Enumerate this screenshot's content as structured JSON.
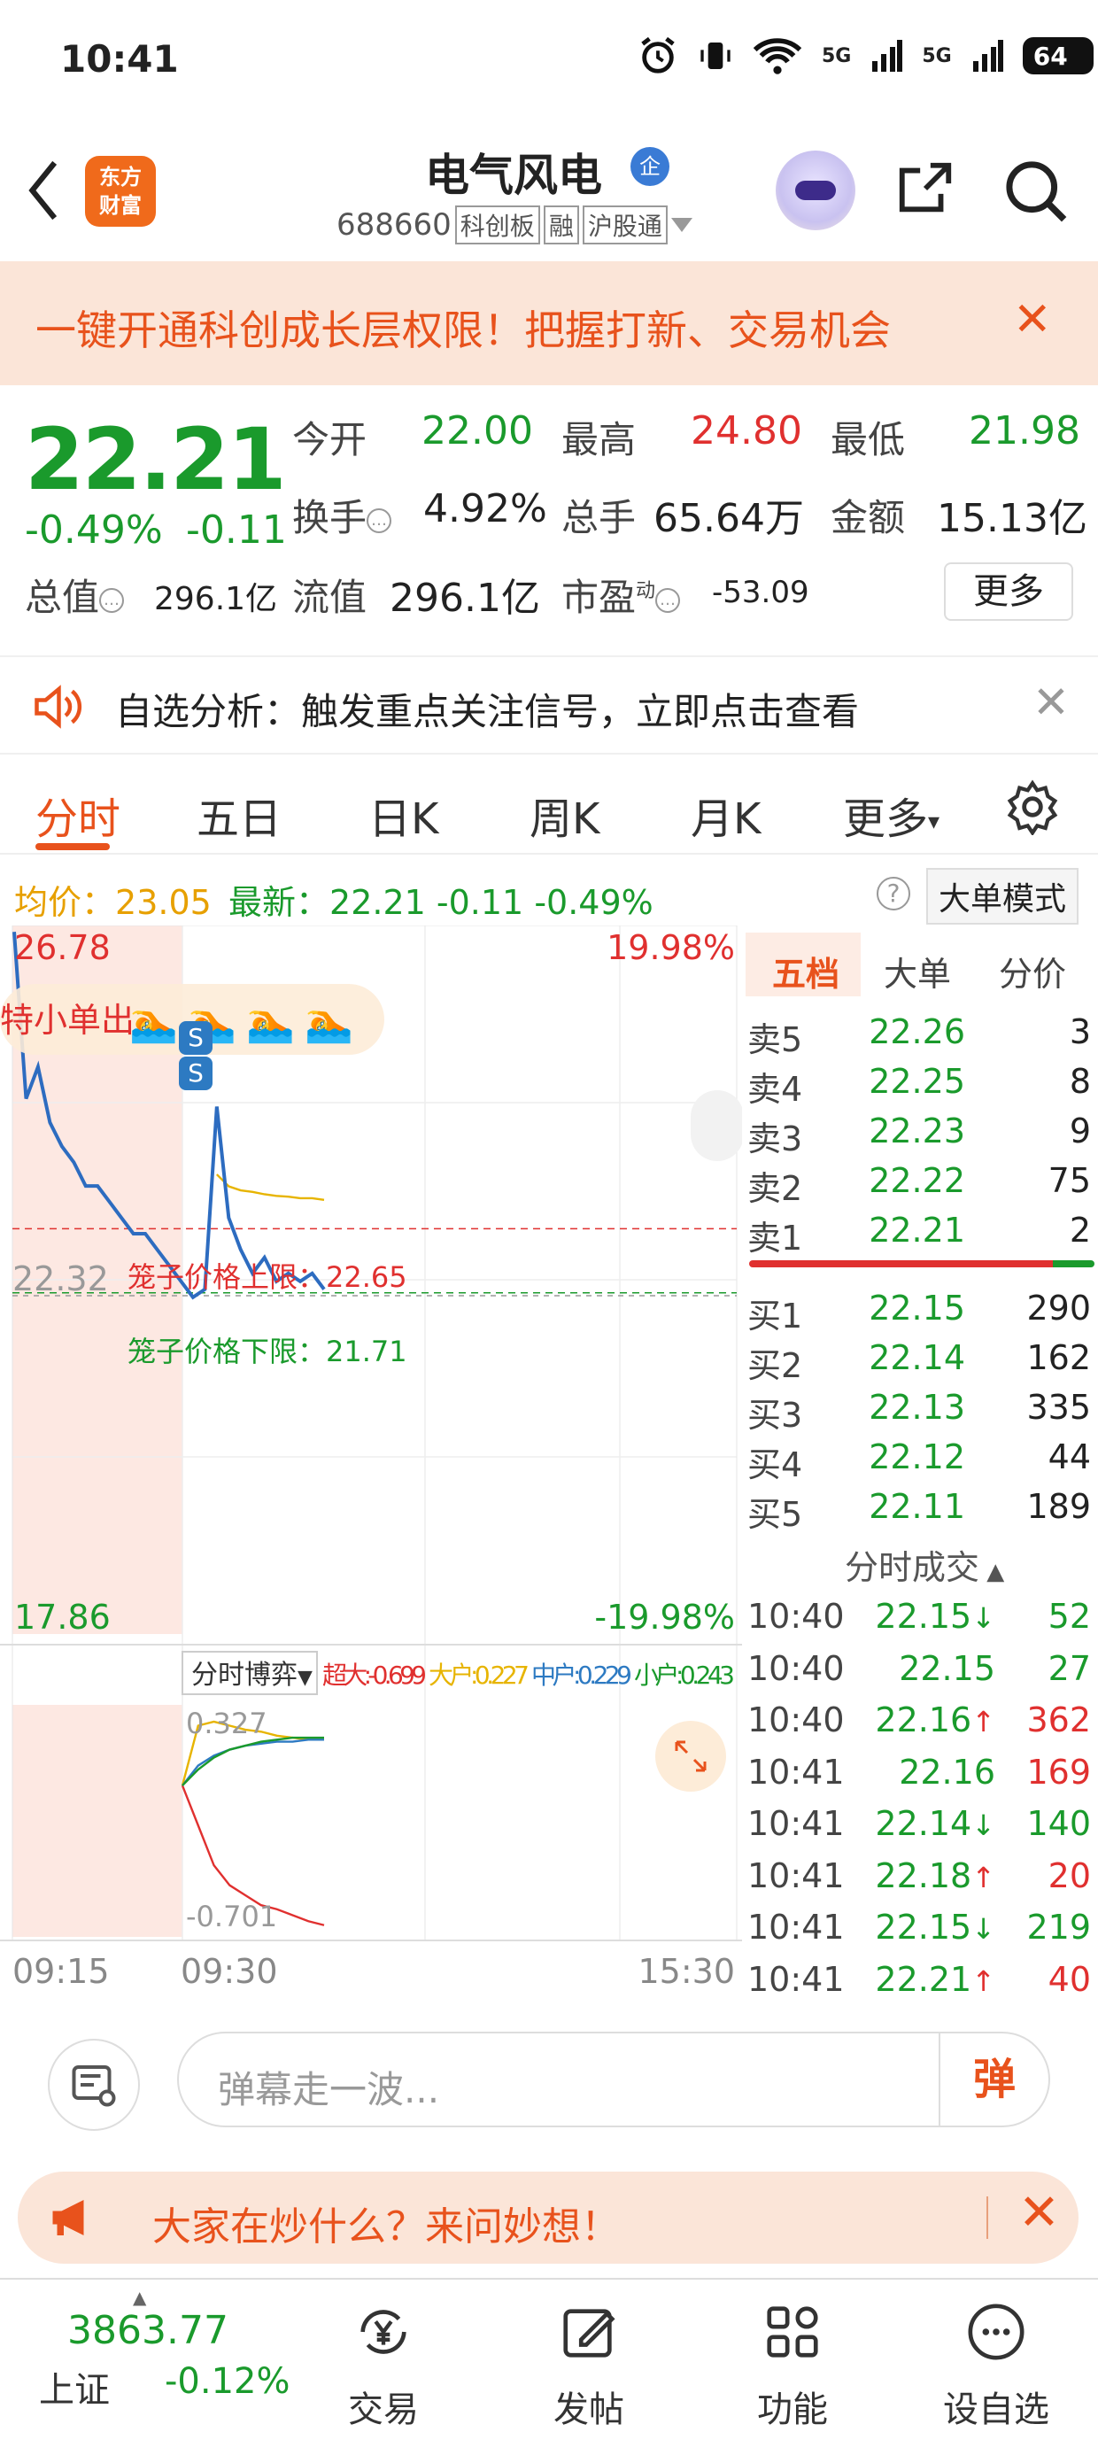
{
  "status": {
    "time": "10:41",
    "signal1": "5G",
    "signal2": "5G",
    "battery": "64"
  },
  "header": {
    "stock_name": "电气风电",
    "badge": "企",
    "code": "688660",
    "tags": [
      "科创板",
      "融",
      "沪股通"
    ],
    "logo_line1": "东方",
    "logo_line2": "财富"
  },
  "banner": {
    "text": "一键开通科创成长层权限！把握打新、交易机会"
  },
  "quote": {
    "price": "22.21",
    "change_pct": "-0.49%",
    "change": "-0.11",
    "open_label": "今开",
    "open": "22.00",
    "high_label": "最高",
    "high": "24.80",
    "low_label": "最低",
    "low": "21.98",
    "turnover_label": "换手",
    "turnover": "4.92%",
    "volume_label": "总手",
    "volume": "65.64万",
    "amount_label": "金额",
    "amount": "15.13亿",
    "mcap_label": "总值",
    "mcap": "296.1亿",
    "float_label": "流值",
    "float": "296.1亿",
    "pe_label": "市盈",
    "pe_sup": "动",
    "pe": "-53.09",
    "more": "更多"
  },
  "analysis": {
    "text": "自选分析：触发重点关注信号，立即点击查看"
  },
  "tabs": [
    "分时",
    "五日",
    "日K",
    "周K",
    "月K",
    "更多"
  ],
  "info": {
    "avg_label": "均价：",
    "avg": "23.05",
    "latest_label": "最新：",
    "latest": "22.21",
    "latest_chg": "-0.11",
    "latest_pct": "-0.49%",
    "mode_btn": "大单模式"
  },
  "chart_data": {
    "type": "line",
    "title": "",
    "xlabel": "",
    "ylabel": "",
    "y_max_label": "26.78",
    "y_min_label": "17.86",
    "y_mid_label": "22.32",
    "pct_max_label": "19.98%",
    "pct_min_label": "-19.98%",
    "ylim": [
      17.86,
      26.78
    ],
    "x_ticks": [
      "09:15",
      "09:30",
      "15:30"
    ],
    "flag_text": "特小单出",
    "cage_upper": "笼子价格上限：22.65",
    "cage_upper_value": 22.65,
    "cage_lower": "笼子价格下限：21.71",
    "cage_lower_value": 21.71,
    "series": [
      {
        "values": [
          26.7,
          24.6,
          25.0,
          24.3,
          24.0,
          23.8,
          23.5,
          23.5,
          23.3,
          23.1,
          22.9,
          22.9,
          22.7,
          22.5,
          22.3,
          22.1,
          22.2,
          24.5,
          23.1,
          22.7,
          22.4,
          22.6,
          22.3,
          22.4,
          22.3,
          22.4,
          22.2
        ]
      },
      {
        "values": [
          null,
          null,
          null,
          null,
          null,
          null,
          null,
          null,
          null,
          null,
          null,
          null,
          null,
          null,
          null,
          null,
          null,
          23.2,
          23.05,
          23.0,
          22.98,
          22.95,
          22.93,
          22.92,
          22.9,
          22.9,
          22.88
        ]
      }
    ],
    "sub_chart": {
      "label": "分时博弈",
      "legend": [
        {
          "name": "超大:-0.699",
          "color": "#e0302f"
        },
        {
          "name": "大户:0.227",
          "color": "#e7b400"
        },
        {
          "name": "中户:0.229",
          "color": "#2d7ac2"
        },
        {
          "name": "小户:0.243",
          "color": "#1a9a2c"
        }
      ],
      "y_top_label": "0.327",
      "y_bottom_label": "-0.701",
      "series": [
        {
          "name": "超大",
          "values": [
            0,
            -0.2,
            -0.4,
            -0.5,
            -0.55,
            -0.6,
            -0.62,
            -0.65,
            -0.68,
            -0.7
          ]
        },
        {
          "name": "大户",
          "values": [
            0,
            0.3,
            0.32,
            0.3,
            0.28,
            0.27,
            0.25,
            0.24,
            0.23,
            0.23
          ]
        },
        {
          "name": "中户",
          "values": [
            0,
            0.1,
            0.15,
            0.18,
            0.2,
            0.21,
            0.22,
            0.22,
            0.23,
            0.23
          ]
        },
        {
          "name": "小户",
          "values": [
            0,
            0.08,
            0.14,
            0.18,
            0.2,
            0.22,
            0.23,
            0.24,
            0.24,
            0.24
          ]
        }
      ]
    }
  },
  "book": {
    "tabs": [
      "五档",
      "大单",
      "分价"
    ],
    "asks": [
      {
        "label": "卖5",
        "price": "22.26",
        "vol": "3"
      },
      {
        "label": "卖4",
        "price": "22.25",
        "vol": "8"
      },
      {
        "label": "卖3",
        "price": "22.23",
        "vol": "9"
      },
      {
        "label": "卖2",
        "price": "22.22",
        "vol": "75"
      },
      {
        "label": "卖1",
        "price": "22.21",
        "vol": "2"
      }
    ],
    "bids": [
      {
        "label": "买1",
        "price": "22.15",
        "vol": "290"
      },
      {
        "label": "买2",
        "price": "22.14",
        "vol": "162"
      },
      {
        "label": "买3",
        "price": "22.13",
        "vol": "335"
      },
      {
        "label": "买4",
        "price": "22.12",
        "vol": "44"
      },
      {
        "label": "买5",
        "price": "22.11",
        "vol": "189"
      }
    ],
    "ticks_title": "分时成交",
    "ticks": [
      {
        "time": "10:40",
        "price": "22.15",
        "dir": "↓",
        "vol": "52",
        "color": "#1a9a2c"
      },
      {
        "time": "10:40",
        "price": "22.15",
        "dir": "",
        "vol": "27",
        "color": "#1a9a2c"
      },
      {
        "time": "10:40",
        "price": "22.16",
        "dir": "↑",
        "vol": "362",
        "color": "#e0302f"
      },
      {
        "time": "10:41",
        "price": "22.16",
        "dir": "",
        "vol": "169",
        "color": "#e0302f"
      },
      {
        "time": "10:41",
        "price": "22.14",
        "dir": "↓",
        "vol": "140",
        "color": "#1a9a2c"
      },
      {
        "time": "10:41",
        "price": "22.18",
        "dir": "↑",
        "vol": "20",
        "color": "#e0302f"
      },
      {
        "time": "10:41",
        "price": "22.15",
        "dir": "↓",
        "vol": "219",
        "color": "#1a9a2c"
      },
      {
        "time": "10:41",
        "price": "22.21",
        "dir": "↑",
        "vol": "40",
        "color": "#e0302f"
      }
    ]
  },
  "input": {
    "placeholder": "弹幕走一波...",
    "send": "弹"
  },
  "ask": {
    "text": "大家在炒什么？来问妙想！"
  },
  "tabbar": {
    "index_value": "3863.77",
    "index_name": "上证",
    "index_chg": "-0.12%",
    "items": [
      "交易",
      "发帖",
      "功能",
      "设自选"
    ]
  },
  "colors": {
    "accent": "#e8521c",
    "up": "#e0302f",
    "down": "#1a9a2c",
    "line": "#2d6cc0"
  }
}
